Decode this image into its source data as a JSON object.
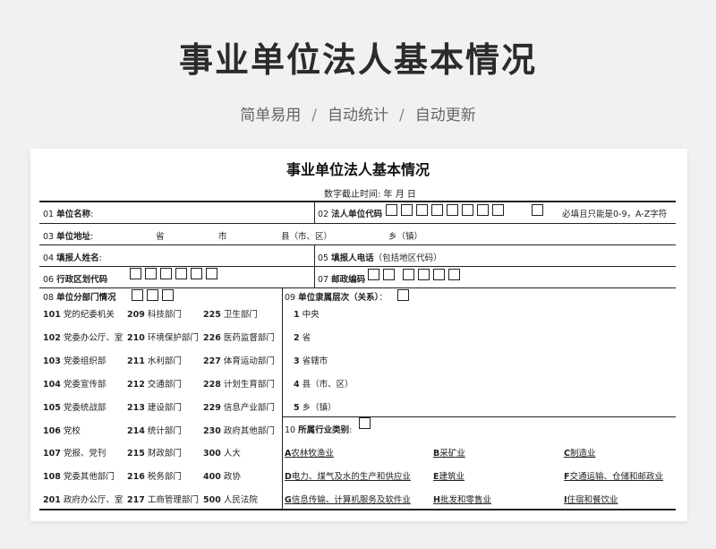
{
  "header": {
    "title": "事业单位法人基本情况",
    "tagline": [
      "简单易用",
      "自动统计",
      "自动更新"
    ],
    "separator": "/"
  },
  "form": {
    "title": "事业单位法人基本情况",
    "date_line": "数字截止时间:   年 月 日",
    "f01": "01 ",
    "f01b": "单位名称",
    "f02": "02 ",
    "f02b": "法人单位代码",
    "f02_note": "必填且只能是0-9，A-Z字符",
    "f03": "03 ",
    "f03b": "单位地址",
    "addr_province": "省",
    "addr_city": "市",
    "addr_county": "县（市、区）",
    "addr_town": "乡（镇）",
    "f04": "04 ",
    "f04b": "填报人姓名",
    "f05": "05 ",
    "f05b": "填报人电话",
    "f05_note": "（包括地区代码）",
    "f06": "06 ",
    "f06b": "行政区划代码",
    "f07": "07 ",
    "f07b": "邮政编码",
    "f08": "08 ",
    "f08b": "单位分部门情况",
    "f09": "09 ",
    "f09b": "单位隶属层次（关系）",
    "f10": "10 ",
    "f10b": "所属行业类别",
    "departments": [
      [
        [
          "101",
          "党的纪委机关"
        ],
        [
          "209",
          "科技部门"
        ],
        [
          "225",
          "卫生部门"
        ]
      ],
      [
        [
          "102",
          "党委办公厅、室"
        ],
        [
          "210",
          "环境保护部门"
        ],
        [
          "226",
          "医药监督部门"
        ]
      ],
      [
        [
          "103",
          "党委组织部"
        ],
        [
          "211",
          "水利部门"
        ],
        [
          "227",
          "体育运动部门"
        ]
      ],
      [
        [
          "104",
          "党委宣传部"
        ],
        [
          "212",
          "交通部门"
        ],
        [
          "228",
          "计划生育部门"
        ]
      ],
      [
        [
          "105",
          "党委统战部"
        ],
        [
          "213",
          "建设部门"
        ],
        [
          "229",
          "信息产业部门"
        ]
      ],
      [
        [
          "106",
          "党校"
        ],
        [
          "214",
          "统计部门"
        ],
        [
          "230",
          "政府其他部门"
        ]
      ],
      [
        [
          "107",
          "党报、党刊"
        ],
        [
          "215",
          "财政部门"
        ],
        [
          "300",
          "人大"
        ]
      ],
      [
        [
          "108",
          "党委其他部门"
        ],
        [
          "216",
          "税务部门"
        ],
        [
          "400",
          "政协"
        ]
      ],
      [
        [
          "201",
          "政府办公厅、室"
        ],
        [
          "217",
          "工商管理部门"
        ],
        [
          "500",
          "人民法院"
        ]
      ]
    ],
    "levels": [
      [
        "1",
        "中央"
      ],
      [
        "2",
        "省"
      ],
      [
        "3",
        "省辖市"
      ],
      [
        "4",
        "县（市、区）"
      ],
      [
        "5",
        "乡（镇）"
      ]
    ],
    "industries": [
      [
        [
          "A",
          "农林牧渔业"
        ],
        [
          "B",
          "采矿业"
        ],
        [
          "C",
          "制造业"
        ]
      ],
      [
        [
          "D",
          "电力、煤气及水的生产和供应业"
        ],
        [
          "E",
          "建筑业"
        ],
        [
          "F",
          "交通运输、仓储和邮政业"
        ]
      ],
      [
        [
          "G",
          "信息传输、计算机服务及软件业"
        ],
        [
          "H",
          "批发和零售业"
        ],
        [
          "I",
          "住宿和餐饮业"
        ]
      ]
    ]
  }
}
